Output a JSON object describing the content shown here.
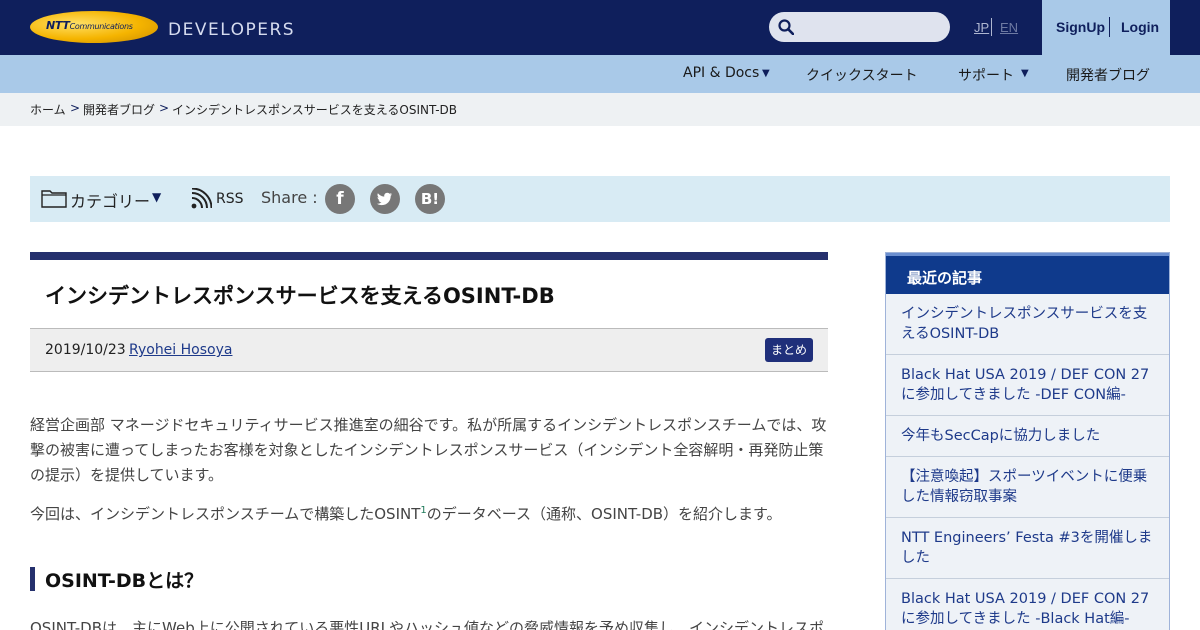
{
  "header": {
    "logo_brand": "NTT",
    "logo_sub": "Communications",
    "site_name": "DEVELOPERS",
    "search_placeholder": "",
    "lang": {
      "jp": "JP",
      "en": "EN"
    },
    "signup": "SignUp",
    "login": "Login"
  },
  "nav": {
    "items": [
      {
        "label": "API & Docs",
        "has_dropdown": true
      },
      {
        "label": "クイックスタート",
        "has_dropdown": false
      },
      {
        "label": "サポート",
        "has_dropdown": true
      },
      {
        "label": "開発者ブログ",
        "has_dropdown": false
      }
    ],
    "dropdown_glyph": "▼"
  },
  "breadcrumb": {
    "items": [
      "ホーム",
      "開発者ブログ",
      "インシデントレスポンスサービスを支えるOSINT-DB"
    ],
    "separator": ">"
  },
  "toolbar": {
    "category_label": "カテゴリー",
    "category_arrow": "▼",
    "rss_label": "RSS",
    "share_label": "Share :",
    "share_buttons": {
      "facebook": "f",
      "hatena": "B!"
    }
  },
  "article": {
    "title": "インシデントレスポンスサービスを支えるOSINT-DB",
    "date": "2019/10/23",
    "author": "Ryohei Hosoya",
    "tag": "まとめ",
    "para1": "経営企画部 マネージドセキュリティサービス推進室の細谷です。私が所属するインシデントレスポンスチームでは、攻撃の被害に遭ってしまったお客様を対象としたインシデントレスポンスサービス（インシデント全容解明・再発防止策の提示）を提供しています。",
    "para2_before": "今回は、インシデントレスポンスチームで構築したOSINT",
    "para2_footnote": "1",
    "para2_after": "のデータベース（通称、OSINT-DB）を紹介します。",
    "h2": "OSINT-DBとは？",
    "para3": "OSINT-DBは、主にWeb上に公開されている悪性URLやハッシュ値などの脅威情報を予め収集し、インシデントレスポ"
  },
  "sidebar": {
    "title": "最近の記事",
    "items": [
      "インシデントレスポンスサービスを支えるOSINT-DB",
      "Black Hat USA 2019 / DEF CON 27に参加してきました -DEF CON編-",
      "今年もSecCapに協力しました",
      "【注意喚起】スポーツイベントに便乗した情報窃取事案",
      "NTT Engineers’ Festa #3を開催しました",
      "Black Hat USA 2019 / DEF CON 27に参加してきました -Black Hat編-"
    ]
  },
  "colors": {
    "header_bg": "#0f1f5c",
    "nav_bg": "#a9c9e8",
    "toolbar_bg": "#d8ebf4",
    "accent": "#25306d",
    "link": "#1e3a8a",
    "sidebar_head": "#0f3a8c"
  },
  "icons": [
    "search-icon",
    "folder-icon",
    "rss-icon",
    "facebook-icon",
    "twitter-icon",
    "hatena-bookmark-icon"
  ]
}
